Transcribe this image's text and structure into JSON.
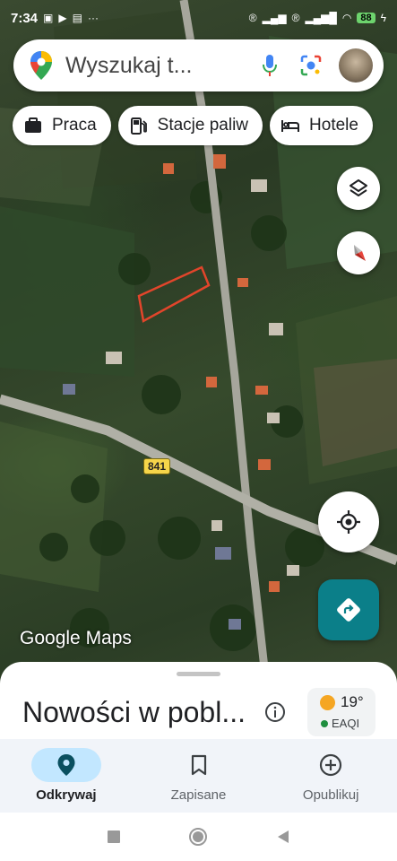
{
  "status_bar": {
    "time": "7:34",
    "battery": "88"
  },
  "search": {
    "placeholder": "Wyszukaj t..."
  },
  "chips": [
    {
      "label": "Praca",
      "icon": "briefcase-icon"
    },
    {
      "label": "Stacje paliw",
      "icon": "gas-station-icon"
    },
    {
      "label": "Hotele",
      "icon": "hotel-bed-icon"
    }
  ],
  "map": {
    "road_number": "841",
    "logo_google": "Google",
    "logo_maps": "Maps",
    "boundary_color": "#e2452b"
  },
  "sheet": {
    "title": "Nowości w pobl...",
    "weather": {
      "temperature": "19°",
      "aqi_label": "EAQI"
    }
  },
  "bottom_nav": {
    "items": [
      {
        "label": "Odkrywaj",
        "icon": "location-pin-icon",
        "active": true
      },
      {
        "label": "Zapisane",
        "icon": "bookmark-icon",
        "active": false
      },
      {
        "label": "Opublikuj",
        "icon": "add-circle-icon",
        "active": false
      }
    ]
  },
  "colors": {
    "accent": "#0b7f89",
    "active_pill": "#c2e7ff"
  }
}
